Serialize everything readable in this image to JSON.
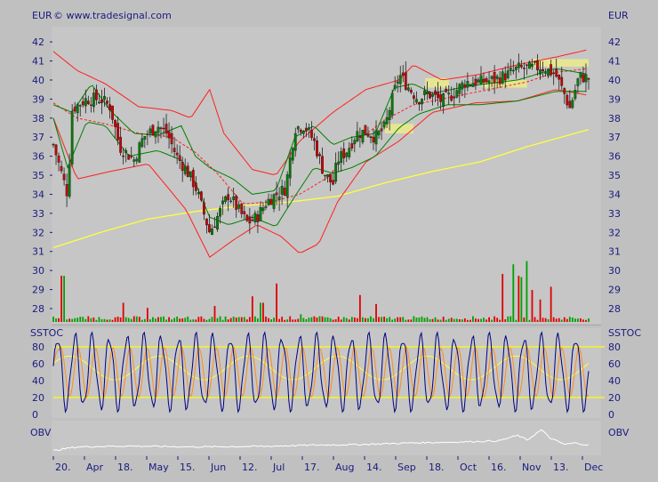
{
  "header": {
    "currency_left": "EUR",
    "currency_right": "EUR",
    "copyright": "© www.tradesignal.com"
  },
  "colors": {
    "background": "#c0c0c0",
    "plot_bg": "#c6c6c6",
    "text": "#1a1a80",
    "bollinger": "#ff2020",
    "bollinger_mid": "#ff2020",
    "keltner": "#008000",
    "sma": "#ffff40",
    "volume_up": "#00a000",
    "volume_down": "#e00000",
    "stoch_k": "#000080",
    "stoch_d": "#ff8c1a",
    "stoch_slow": "#ffff40",
    "stoch_levels": "#ffff00",
    "obv": "#ffffff",
    "candle_up": "#008000",
    "candle_down": "#cc0000",
    "highlight": "#f0f080"
  },
  "chart_data": [
    {
      "type": "candlestick",
      "panel": "price",
      "y_ticks": [
        28,
        29,
        30,
        31,
        32,
        33,
        34,
        35,
        36,
        37,
        38,
        39,
        40,
        41,
        42
      ],
      "ylim": [
        27.3,
        42.8
      ],
      "x_ticks": [
        "20.",
        "Apr",
        "18.",
        "May",
        "15.",
        "Jun",
        "12.",
        "Jul",
        "17.",
        "Aug",
        "14.",
        "Sep",
        "18.",
        "Oct",
        "16.",
        "Nov",
        "13.",
        "Dec"
      ],
      "n_bars": 200,
      "close_path": [
        [
          0,
          36.6
        ],
        [
          6,
          34.0
        ],
        [
          8,
          38.5
        ],
        [
          14,
          39.0
        ],
        [
          20,
          39.0
        ],
        [
          24,
          38.6
        ],
        [
          28,
          36.5
        ],
        [
          34,
          35.8
        ],
        [
          38,
          37.0
        ],
        [
          44,
          37.6
        ],
        [
          48,
          37.2
        ],
        [
          52,
          36.0
        ],
        [
          56,
          35.3
        ],
        [
          60,
          34.4
        ],
        [
          64,
          32.8
        ],
        [
          66,
          32.0
        ],
        [
          70,
          33.0
        ],
        [
          74,
          34.0
        ],
        [
          78,
          33.2
        ],
        [
          82,
          32.5
        ],
        [
          86,
          32.8
        ],
        [
          90,
          33.6
        ],
        [
          94,
          34.0
        ],
        [
          98,
          34.3
        ],
        [
          102,
          37.5
        ],
        [
          106,
          37.6
        ],
        [
          110,
          36.8
        ],
        [
          114,
          35.2
        ],
        [
          118,
          34.5
        ],
        [
          120,
          35.8
        ],
        [
          124,
          36.3
        ],
        [
          128,
          37.2
        ],
        [
          132,
          37.3
        ],
        [
          136,
          37.0
        ],
        [
          140,
          37.5
        ],
        [
          142,
          38.5
        ],
        [
          146,
          40.3
        ],
        [
          150,
          39.6
        ],
        [
          154,
          39.0
        ],
        [
          158,
          39.3
        ],
        [
          164,
          38.9
        ],
        [
          168,
          39.2
        ],
        [
          174,
          39.9
        ],
        [
          180,
          39.9
        ],
        [
          186,
          40.0
        ],
        [
          192,
          40.3
        ],
        [
          196,
          40.6
        ],
        [
          200,
          40.6
        ],
        [
          206,
          40.7
        ],
        [
          212,
          40.3
        ],
        [
          216,
          39.2
        ],
        [
          218,
          38.5
        ],
        [
          222,
          40.2
        ],
        [
          226,
          40.1
        ]
      ],
      "bollinger_upper": [
        [
          0,
          41.5
        ],
        [
          10,
          40.5
        ],
        [
          22,
          39.8
        ],
        [
          36,
          38.6
        ],
        [
          50,
          38.4
        ],
        [
          58,
          38.0
        ],
        [
          66,
          39.5
        ],
        [
          72,
          37.2
        ],
        [
          84,
          35.3
        ],
        [
          94,
          35.0
        ],
        [
          104,
          36.8
        ],
        [
          118,
          38.3
        ],
        [
          132,
          39.5
        ],
        [
          146,
          40.0
        ],
        [
          152,
          40.8
        ],
        [
          164,
          40.0
        ],
        [
          180,
          40.3
        ],
        [
          196,
          40.8
        ],
        [
          212,
          41.2
        ],
        [
          226,
          41.6
        ]
      ],
      "bollinger_lower": [
        [
          0,
          38.0
        ],
        [
          10,
          34.8
        ],
        [
          24,
          35.2
        ],
        [
          40,
          35.6
        ],
        [
          56,
          33.2
        ],
        [
          66,
          30.7
        ],
        [
          76,
          31.6
        ],
        [
          86,
          32.4
        ],
        [
          96,
          31.8
        ],
        [
          104,
          30.9
        ],
        [
          112,
          31.4
        ],
        [
          120,
          33.6
        ],
        [
          132,
          35.7
        ],
        [
          146,
          36.8
        ],
        [
          160,
          38.3
        ],
        [
          178,
          38.8
        ],
        [
          196,
          38.9
        ],
        [
          212,
          39.5
        ],
        [
          226,
          39.2
        ]
      ],
      "bollinger_mid": [
        [
          0,
          38.8
        ],
        [
          10,
          38.0
        ],
        [
          22,
          37.7
        ],
        [
          36,
          37.2
        ],
        [
          50,
          37.0
        ],
        [
          60,
          36.2
        ],
        [
          70,
          35.0
        ],
        [
          80,
          33.5
        ],
        [
          92,
          33.6
        ],
        [
          104,
          34.0
        ],
        [
          116,
          34.9
        ],
        [
          128,
          36.8
        ],
        [
          140,
          37.9
        ],
        [
          152,
          38.7
        ],
        [
          168,
          39.1
        ],
        [
          184,
          39.5
        ],
        [
          200,
          39.9
        ],
        [
          212,
          40.4
        ],
        [
          226,
          40.6
        ]
      ],
      "keltner_upper": [
        [
          0,
          38.7
        ],
        [
          8,
          38.3
        ],
        [
          16,
          39.8
        ],
        [
          24,
          38.4
        ],
        [
          34,
          37.2
        ],
        [
          44,
          37.1
        ],
        [
          54,
          37.6
        ],
        [
          60,
          36.0
        ],
        [
          66,
          35.4
        ],
        [
          76,
          34.8
        ],
        [
          84,
          34.0
        ],
        [
          94,
          34.2
        ],
        [
          102,
          37.0
        ],
        [
          110,
          37.6
        ],
        [
          118,
          36.6
        ],
        [
          126,
          37.0
        ],
        [
          136,
          37.2
        ],
        [
          144,
          39.6
        ],
        [
          152,
          39.8
        ],
        [
          160,
          39.3
        ],
        [
          176,
          39.7
        ],
        [
          196,
          40.0
        ],
        [
          212,
          40.6
        ],
        [
          226,
          40.3
        ]
      ],
      "keltner_lower": [
        [
          0,
          38.0
        ],
        [
          6,
          35.4
        ],
        [
          14,
          37.8
        ],
        [
          22,
          37.6
        ],
        [
          32,
          36.0
        ],
        [
          44,
          36.3
        ],
        [
          54,
          35.8
        ],
        [
          60,
          34.6
        ],
        [
          66,
          32.8
        ],
        [
          74,
          32.4
        ],
        [
          84,
          32.8
        ],
        [
          94,
          32.3
        ],
        [
          102,
          33.9
        ],
        [
          110,
          35.4
        ],
        [
          118,
          35.1
        ],
        [
          126,
          35.4
        ],
        [
          136,
          36.0
        ],
        [
          146,
          37.5
        ],
        [
          154,
          38.2
        ],
        [
          166,
          38.7
        ],
        [
          180,
          38.7
        ],
        [
          196,
          38.9
        ],
        [
          212,
          39.4
        ],
        [
          226,
          39.4
        ]
      ],
      "sma_path": [
        [
          0,
          31.2
        ],
        [
          20,
          32.0
        ],
        [
          40,
          32.7
        ],
        [
          60,
          33.1
        ],
        [
          80,
          33.4
        ],
        [
          100,
          33.6
        ],
        [
          120,
          33.9
        ],
        [
          140,
          34.6
        ],
        [
          160,
          35.2
        ],
        [
          180,
          35.7
        ],
        [
          200,
          36.5
        ],
        [
          226,
          37.4
        ]
      ],
      "highlights": [
        {
          "x0": 140,
          "x1": 152,
          "y0": 37.2,
          "y1": 37.7
        },
        {
          "x0": 157,
          "x1": 167,
          "y0": 39.6,
          "y1": 40.1
        },
        {
          "x0": 181,
          "x1": 200,
          "y0": 39.6,
          "y1": 40.0
        },
        {
          "x0": 202,
          "x1": 226,
          "y0": 40.7,
          "y1": 41.1
        }
      ]
    },
    {
      "type": "bar",
      "panel": "volume",
      "volume_spikes": [
        {
          "x": 4,
          "v": 0.72
        },
        {
          "x": 30,
          "v": 0.3
        },
        {
          "x": 40,
          "v": 0.22
        },
        {
          "x": 68,
          "v": 0.25
        },
        {
          "x": 84,
          "v": 0.4
        },
        {
          "x": 88,
          "v": 0.3
        },
        {
          "x": 94,
          "v": 0.6
        },
        {
          "x": 104,
          "v": 0.12
        },
        {
          "x": 130,
          "v": 0.42
        },
        {
          "x": 136,
          "v": 0.28
        },
        {
          "x": 190,
          "v": 0.75
        },
        {
          "x": 194,
          "v": 0.9
        },
        {
          "x": 196,
          "v": 0.72
        },
        {
          "x": 198,
          "v": 0.7
        },
        {
          "x": 200,
          "v": 0.95
        },
        {
          "x": 202,
          "v": 0.5
        },
        {
          "x": 206,
          "v": 0.35
        },
        {
          "x": 210,
          "v": 0.55
        }
      ]
    },
    {
      "type": "line",
      "panel": "stochastic",
      "label_left": "SSTOC",
      "label_right": "SSTOC",
      "y_ticks": [
        0,
        20,
        40,
        60,
        80
      ],
      "ylim": [
        0,
        100
      ],
      "levels": [
        20,
        80
      ],
      "k_cycles": 31,
      "series": []
    },
    {
      "type": "line",
      "panel": "obv",
      "label_left": "OBV",
      "label_right": "OBV",
      "obv_path": [
        [
          0,
          0.1
        ],
        [
          10,
          0.22
        ],
        [
          30,
          0.25
        ],
        [
          60,
          0.22
        ],
        [
          90,
          0.24
        ],
        [
          110,
          0.28
        ],
        [
          130,
          0.3
        ],
        [
          150,
          0.35
        ],
        [
          170,
          0.38
        ],
        [
          188,
          0.42
        ],
        [
          196,
          0.6
        ],
        [
          200,
          0.45
        ],
        [
          206,
          0.78
        ],
        [
          210,
          0.5
        ],
        [
          216,
          0.3
        ],
        [
          220,
          0.35
        ],
        [
          226,
          0.28
        ]
      ]
    }
  ]
}
